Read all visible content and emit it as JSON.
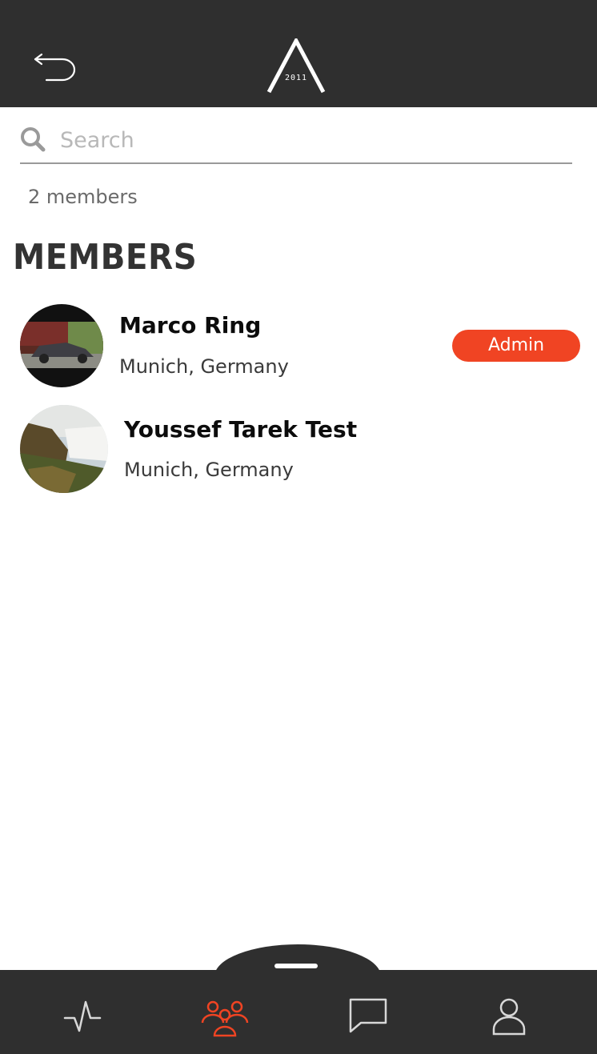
{
  "header": {
    "back_icon": "back-arrow-icon",
    "logo_year": "2011"
  },
  "search": {
    "placeholder": "Search",
    "value": "",
    "icon": "search-icon"
  },
  "member_count": "2 members",
  "section_title": "MEMBERS",
  "members": [
    {
      "name": "Marco Ring",
      "location": "Munich, Germany",
      "badge": "Admin"
    },
    {
      "name": "Youssef Tarek Test",
      "location": "Munich, Germany"
    }
  ],
  "tabbar": {
    "items": [
      {
        "icon": "activity-icon",
        "active": false
      },
      {
        "icon": "members-icon",
        "active": true
      },
      {
        "icon": "chat-icon",
        "active": false
      },
      {
        "icon": "profile-icon",
        "active": false
      }
    ]
  },
  "colors": {
    "header_bg": "#2f2f2f",
    "accent": "#f04423",
    "tab_icon": "#d8d8d8"
  }
}
